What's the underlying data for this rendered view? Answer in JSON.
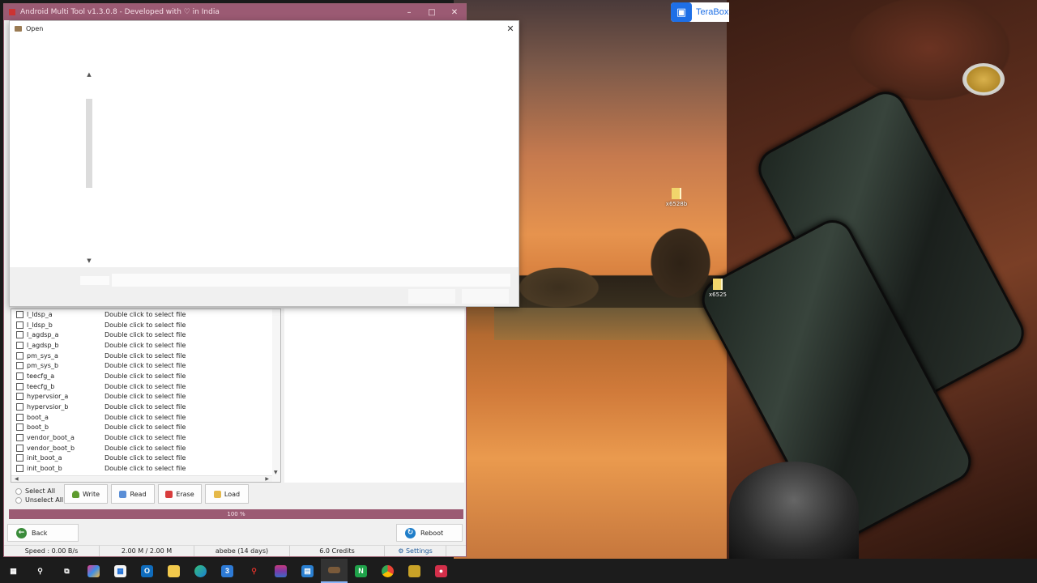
{
  "app": {
    "title": "Android Multi Tool v1.3.0.8 - Developed with ♡ in India",
    "window_controls": [
      "–",
      "□",
      "✕"
    ]
  },
  "open_dialog": {
    "title": "Open",
    "close": "✕"
  },
  "partitions": [
    {
      "name": "l_ldsp_a",
      "file": "Double click to select file"
    },
    {
      "name": "l_ldsp_b",
      "file": "Double click to select file"
    },
    {
      "name": "l_agdsp_a",
      "file": "Double click to select file"
    },
    {
      "name": "l_agdsp_b",
      "file": "Double click to select file"
    },
    {
      "name": "pm_sys_a",
      "file": "Double click to select file"
    },
    {
      "name": "pm_sys_b",
      "file": "Double click to select file"
    },
    {
      "name": "teecfg_a",
      "file": "Double click to select file"
    },
    {
      "name": "teecfg_b",
      "file": "Double click to select file"
    },
    {
      "name": "hypervsior_a",
      "file": "Double click to select file"
    },
    {
      "name": "hypervsior_b",
      "file": "Double click to select file"
    },
    {
      "name": "boot_a",
      "file": "Double click to select file"
    },
    {
      "name": "boot_b",
      "file": "Double click to select file"
    },
    {
      "name": "vendor_boot_a",
      "file": "Double click to select file"
    },
    {
      "name": "vendor_boot_b",
      "file": "Double click to select file"
    },
    {
      "name": "init_boot_a",
      "file": "Double click to select file"
    },
    {
      "name": "init_boot_b",
      "file": "Double click to select file"
    }
  ],
  "selection": {
    "select_all": "Select All",
    "unselect_all": "Unselect All"
  },
  "actions": {
    "write": "Write",
    "read": "Read",
    "erase": "Erase",
    "load": "Load"
  },
  "progress": {
    "label": "100 %",
    "value": 100
  },
  "nav": {
    "back": "Back",
    "reboot": "Reboot"
  },
  "status": {
    "speed": "Speed : 0.00 B/s",
    "size": "2.00 M / 2.00 M",
    "user": "abebe (14 days)",
    "credits": "6.0 Credits",
    "settings": "Settings"
  },
  "desktop": {
    "icons": [
      {
        "label": "x6528b"
      },
      {
        "label": "x6525"
      }
    ],
    "terabox": "TeraBox"
  },
  "taskbar": {
    "items": [
      "start",
      "search",
      "task-view",
      "copilot",
      "store",
      "outlook",
      "explorer",
      "edge",
      "app-3",
      "app-red",
      "winrar",
      "app-blue",
      "app-active",
      "app-n",
      "chrome",
      "app-yellow",
      "app-rec"
    ],
    "active_item": "app-active"
  },
  "colors": {
    "accent": "#9b5a73",
    "taskbar": "#1c1c1c",
    "dialog_footer": "#f0f0f0"
  }
}
